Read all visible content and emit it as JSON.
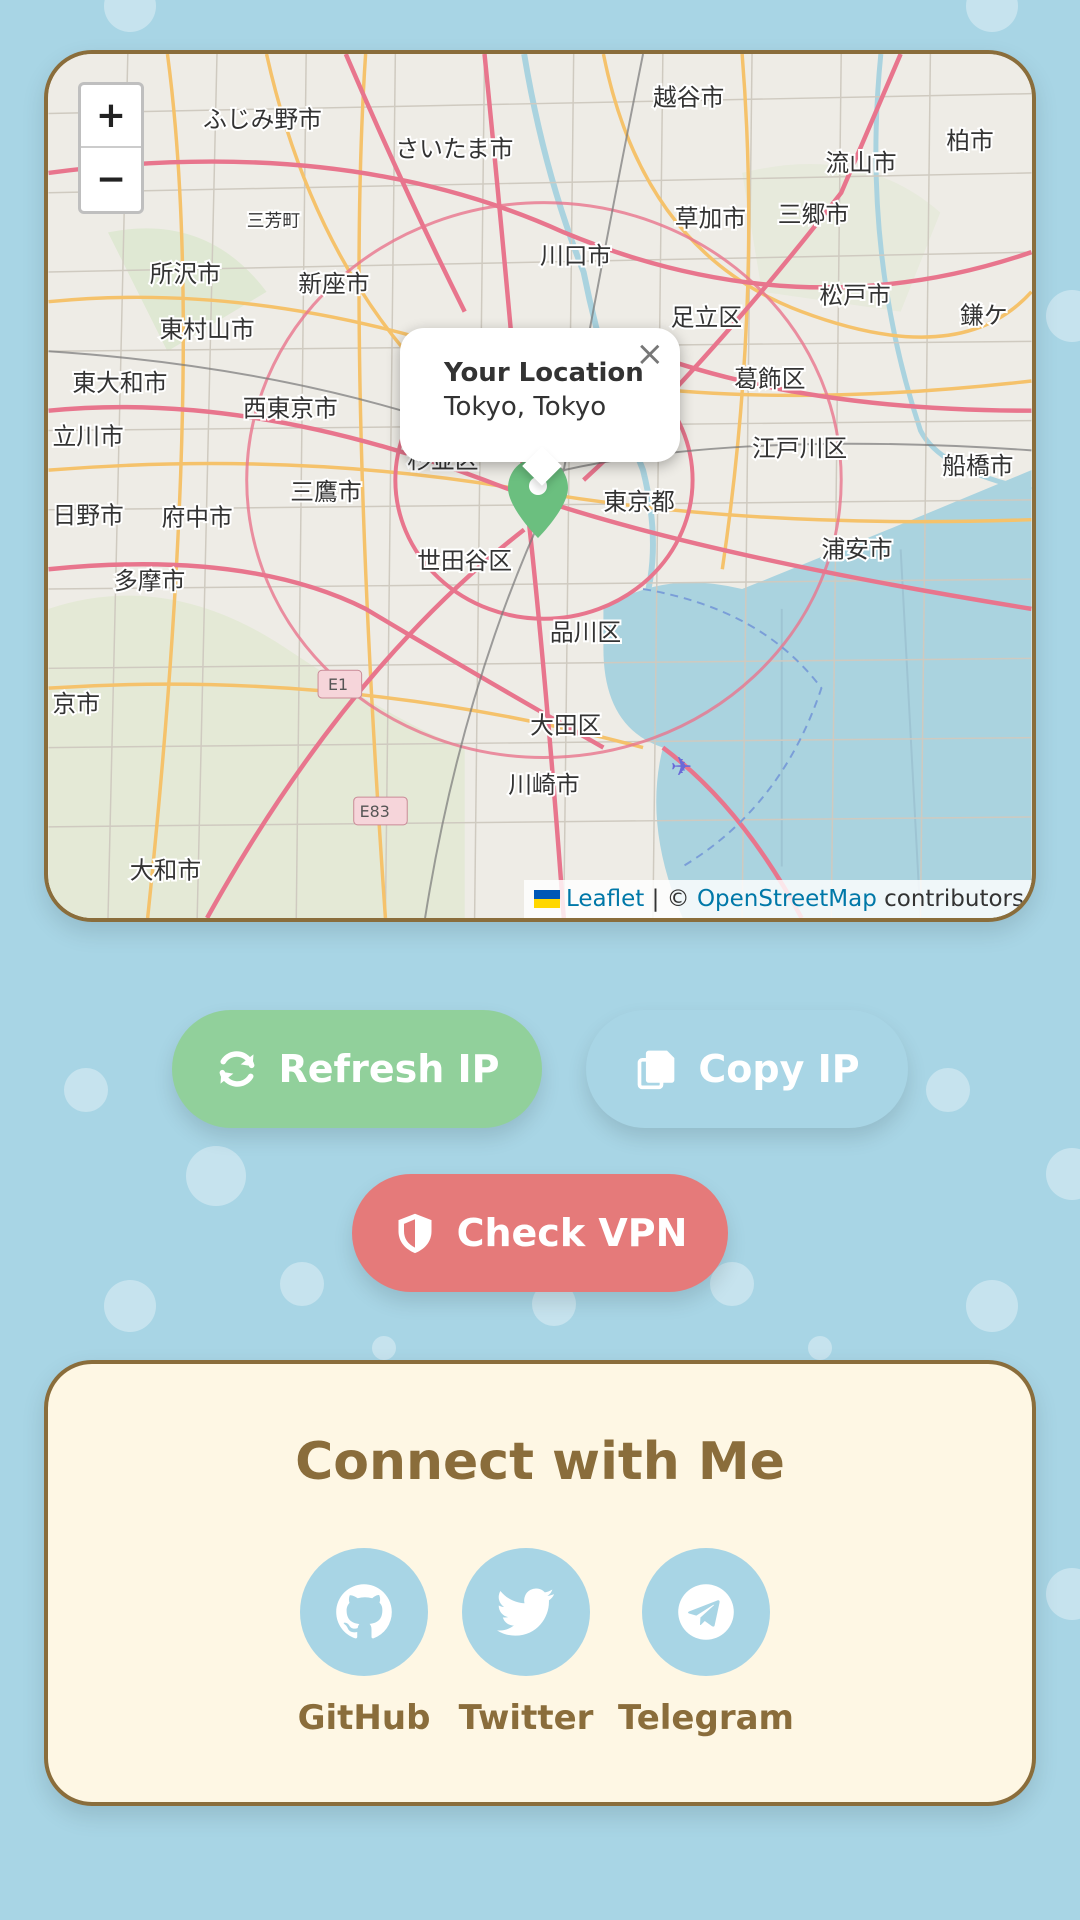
{
  "map": {
    "zoom_in_label": "+",
    "zoom_out_label": "−",
    "popup": {
      "title": "Your Location",
      "subtitle": "Tokyo, Tokyo",
      "close_label": "×"
    },
    "attribution": {
      "leaflet": "Leaflet",
      "separator": " | © ",
      "osm": "OpenStreetMap",
      "suffix": " contributors"
    },
    "place_labels": [
      "越谷市",
      "ふじみ野市",
      "さいたま市",
      "柏市",
      "流山市",
      "三芳町",
      "草加市",
      "三郷市",
      "川口市",
      "所沢市",
      "新座市",
      "松戸市",
      "鎌ケ",
      "東村山市",
      "足立区",
      "東大和市",
      "葛飾区",
      "西東京市",
      "立川市",
      "杉並区",
      "江戸川区",
      "船橋市",
      "三鷹市",
      "東京都",
      "日野市",
      "府中市",
      "浦安市",
      "世田谷区",
      "多摩市",
      "品川区",
      "E1",
      "京市",
      "大田区",
      "川崎市",
      "E83",
      "大和市"
    ],
    "marker_color": "#6bbf7f"
  },
  "actions": {
    "refresh_label": "Refresh IP",
    "copy_label": "Copy IP",
    "vpn_label": "Check VPN"
  },
  "connect": {
    "title": "Connect with Me",
    "links": [
      {
        "label": "GitHub",
        "icon": "github-icon"
      },
      {
        "label": "Twitter",
        "icon": "twitter-icon"
      },
      {
        "label": "Telegram",
        "icon": "telegram-icon"
      }
    ]
  },
  "colors": {
    "background": "#a8d5e5",
    "accent_brown": "#8a6d3b",
    "refresh_green": "#91d09b",
    "vpn_red": "#e57a7a",
    "card_cream": "#fef7e4"
  }
}
